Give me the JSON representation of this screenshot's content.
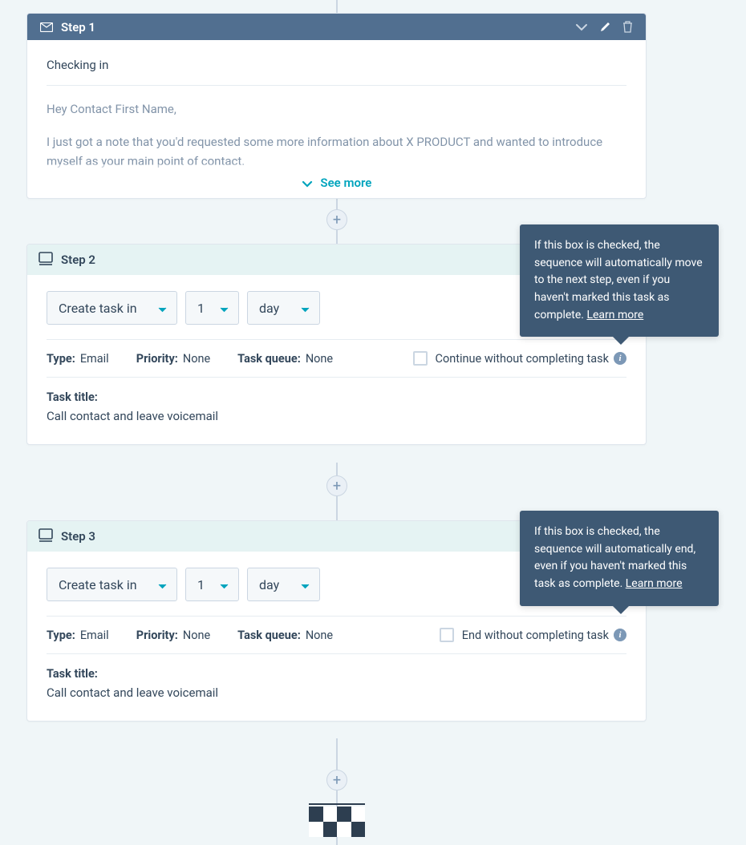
{
  "step1": {
    "title": "Step 1",
    "subject": "Checking in",
    "greeting": "Hey Contact First Name,",
    "body_line": "I just got a note that you'd requested some more information about X PRODUCT and wanted to introduce myself as your main point of contact.",
    "see_more": "See more"
  },
  "step2": {
    "title": "Step 2",
    "action_label": "Create task in",
    "count": "1",
    "unit": "day",
    "type_label": "Type:",
    "type_value": "Email",
    "priority_label": "Priority:",
    "priority_value": "None",
    "queue_label": "Task queue:",
    "queue_value": "None",
    "checkbox_label": "Continue without completing task",
    "task_title_label": "Task title:",
    "task_title_value": "Call contact and leave voicemail"
  },
  "step3": {
    "title": "Step 3",
    "action_label": "Create task in",
    "count": "1",
    "unit": "day",
    "type_label": "Type:",
    "type_value": "Email",
    "priority_label": "Priority:",
    "priority_value": "None",
    "queue_label": "Task queue:",
    "queue_value": "None",
    "checkbox_label": "End without completing task",
    "task_title_label": "Task title:",
    "task_title_value": "Call contact and leave voicemail"
  },
  "tooltip1": {
    "text": "If this box is checked, the sequence will automatically move to the next step, even if you haven't marked this task as complete. ",
    "learn": "Learn more"
  },
  "tooltip2": {
    "text": "If this box is checked, the sequence will automatically end, even if you haven't marked this task as complete. ",
    "learn": "Learn more"
  }
}
